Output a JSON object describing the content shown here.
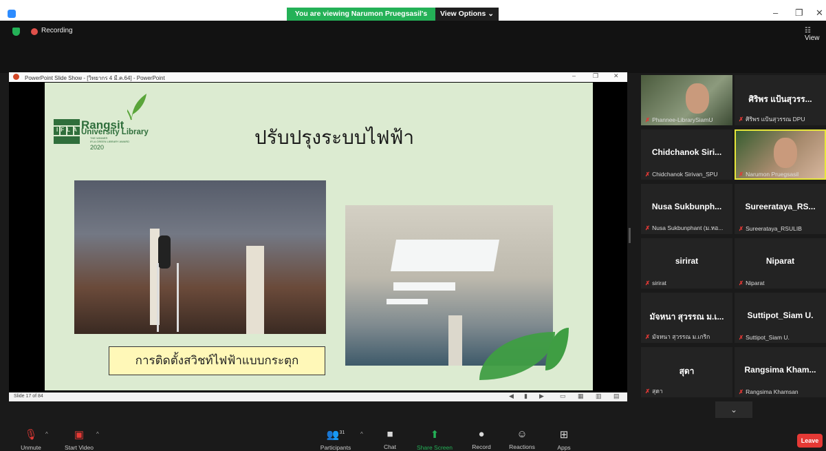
{
  "window": {
    "title": "Zoom Meeting",
    "viewing_banner": "You are viewing Narumon Pruegsasil's screen",
    "view_options": "View Options ⌄",
    "minimize": "–",
    "restore": "❐",
    "close": "✕"
  },
  "top": {
    "recording_label": "Recording",
    "view_label": "☷ View"
  },
  "ppt": {
    "window_title": "PowerPoint Slide Show - [วิทยากร 4 มี.ค.64] - PowerPoint",
    "status": "Slide 17 of 84",
    "controls": [
      "–",
      "❐",
      "✕"
    ]
  },
  "slide": {
    "logo_name": "Rangsit",
    "logo_sub": "University Library",
    "logo_ifla": "IFLA",
    "logo_small": "THE WINNER\nIFLA GREEN LIBRARY AWARD",
    "logo_year": "2020",
    "title": "ปรับปรุงระบบไฟฟ้า",
    "caption": "การติดตั้งสวิชท์ไฟฟ้าแบบกระตุก"
  },
  "gallery": {
    "tiles": [
      {
        "name": "",
        "label": "Phannee-LibrarySiamU",
        "video": true
      },
      {
        "name": "ศิริพร แป้นสุวรร...",
        "label": "ศิริพร แป้นสุวรรณ DPU",
        "video": false
      },
      {
        "name": "Chidchanok Siri...",
        "label": "Chidchanok Sirivan_SPU",
        "video": false
      },
      {
        "name": "",
        "label": "Narumon Pruegsasil",
        "video": true,
        "active": true
      },
      {
        "name": "Nusa Sukbunph...",
        "label": "Nusa Sukbunphant (ม.หอ...",
        "video": false
      },
      {
        "name": "Sureerataya_RS...",
        "label": "Sureerataya_RSULIB",
        "video": false
      },
      {
        "name": "sirirat",
        "label": "sirirat",
        "video": false
      },
      {
        "name": "Niparat",
        "label": "Niparat",
        "video": false
      },
      {
        "name": "มัจหนา สุวรรณ ม.เ...",
        "label": "มัจหนา สุวรรณ ม.เกริก",
        "video": false
      },
      {
        "name": "Suttipot_Siam U.",
        "label": "Suttipot_Siam U.",
        "video": false
      },
      {
        "name": "สุดา",
        "label": "สุดา",
        "video": false
      },
      {
        "name": "Rangsima Kham...",
        "label": "Rangsima Khamsan",
        "video": false
      }
    ],
    "scroll_down": "⌄"
  },
  "toolbar": {
    "unmute": "Unmute",
    "start_video": "Start Video",
    "participants": "Participants",
    "participants_count": "31",
    "chat": "Chat",
    "share_screen": "Share Screen",
    "record": "Record",
    "reactions": "Reactions",
    "apps": "Apps",
    "leave": "Leave"
  }
}
